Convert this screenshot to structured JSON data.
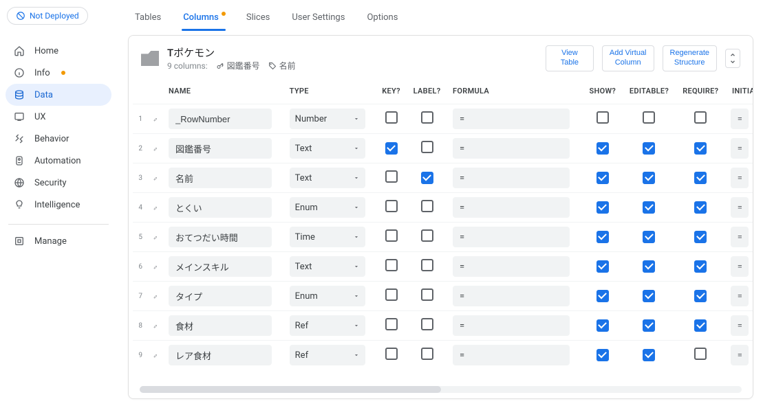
{
  "deploy": {
    "label": "Not Deployed"
  },
  "sidebar": {
    "items": [
      {
        "label": "Home",
        "name": "sidebar-item-home"
      },
      {
        "label": "Info",
        "name": "sidebar-item-info",
        "dot": true
      },
      {
        "label": "Data",
        "name": "sidebar-item-data",
        "active": true
      },
      {
        "label": "UX",
        "name": "sidebar-item-ux"
      },
      {
        "label": "Behavior",
        "name": "sidebar-item-behavior"
      },
      {
        "label": "Automation",
        "name": "sidebar-item-automation"
      },
      {
        "label": "Security",
        "name": "sidebar-item-security"
      },
      {
        "label": "Intelligence",
        "name": "sidebar-item-intelligence"
      }
    ],
    "manage": {
      "label": "Manage"
    }
  },
  "tabs": {
    "items": [
      {
        "label": "Tables",
        "name": "tab-tables"
      },
      {
        "label": "Columns",
        "name": "tab-columns",
        "active": true,
        "dot": true
      },
      {
        "label": "Slices",
        "name": "tab-slices"
      },
      {
        "label": "User Settings",
        "name": "tab-user-settings"
      },
      {
        "label": "Options",
        "name": "tab-options"
      }
    ]
  },
  "panel": {
    "title": "Tポケモン",
    "columns_count_label": "9 columns:",
    "key_tag": "図鑑番号",
    "label_tag": "名前",
    "buttons": {
      "view_table": "View\nTable",
      "add_virtual": "Add Virtual\nColumn",
      "regenerate": "Regenerate\nStructure"
    }
  },
  "grid": {
    "headers": {
      "name": "NAME",
      "type": "TYPE",
      "key": "KEY?",
      "label": "LABEL?",
      "formula": "FORMULA",
      "show": "SHOW?",
      "editable": "EDITABLE?",
      "require": "REQUIRE?",
      "initial": "INITIAL"
    },
    "rows": [
      {
        "idx": "1",
        "name": "_RowNumber",
        "type": "Number",
        "key": false,
        "label": false,
        "formula": "=",
        "show": false,
        "editable": false,
        "require": false,
        "initial": "="
      },
      {
        "idx": "2",
        "name": "図鑑番号",
        "type": "Text",
        "key": true,
        "label": false,
        "formula": "=",
        "show": true,
        "editable": true,
        "require": true,
        "initial": "="
      },
      {
        "idx": "3",
        "name": "名前",
        "type": "Text",
        "key": false,
        "label": true,
        "formula": "=",
        "show": true,
        "editable": true,
        "require": true,
        "initial": "="
      },
      {
        "idx": "4",
        "name": "とくい",
        "type": "Enum",
        "key": false,
        "label": false,
        "formula": "=",
        "show": true,
        "editable": true,
        "require": true,
        "initial": "="
      },
      {
        "idx": "5",
        "name": "おてつだい時間",
        "type": "Time",
        "key": false,
        "label": false,
        "formula": "=",
        "show": true,
        "editable": true,
        "require": true,
        "initial": "="
      },
      {
        "idx": "6",
        "name": "メインスキル",
        "type": "Text",
        "key": false,
        "label": false,
        "formula": "=",
        "show": true,
        "editable": true,
        "require": true,
        "initial": "="
      },
      {
        "idx": "7",
        "name": "タイプ",
        "type": "Enum",
        "key": false,
        "label": false,
        "formula": "=",
        "show": true,
        "editable": true,
        "require": true,
        "initial": "="
      },
      {
        "idx": "8",
        "name": "食材",
        "type": "Ref",
        "key": false,
        "label": false,
        "formula": "=",
        "show": true,
        "editable": true,
        "require": true,
        "initial": "="
      },
      {
        "idx": "9",
        "name": "レア食材",
        "type": "Ref",
        "key": false,
        "label": false,
        "formula": "=",
        "show": true,
        "editable": true,
        "require": false,
        "initial": "="
      }
    ]
  }
}
